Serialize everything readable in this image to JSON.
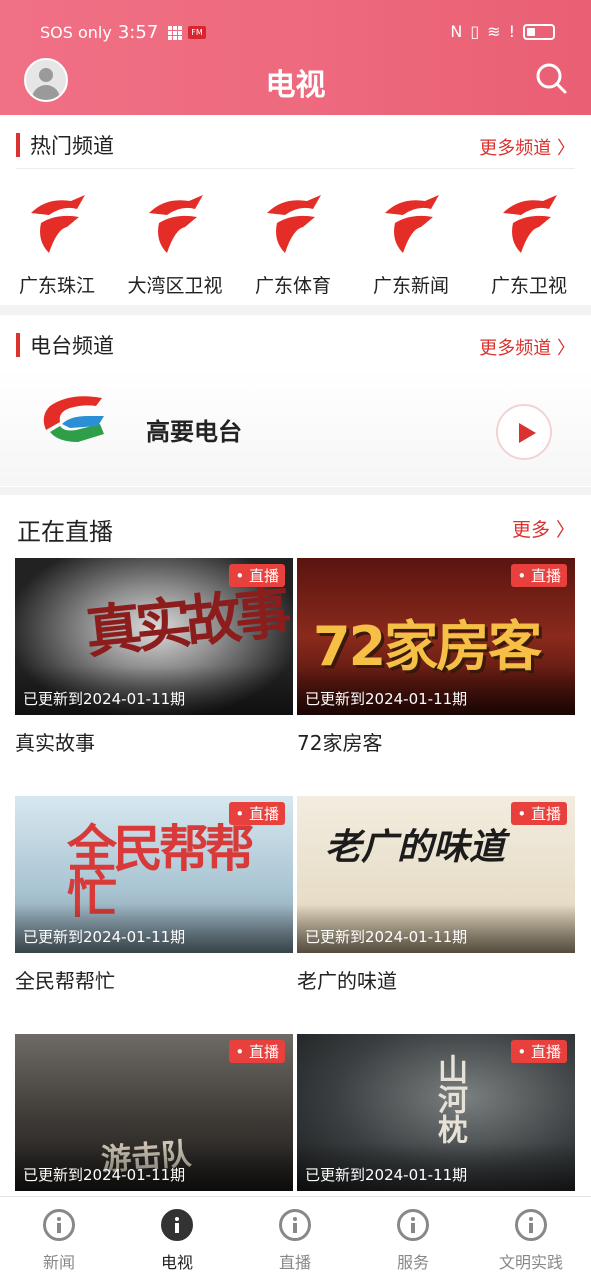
{
  "status_bar": {
    "carrier": "SOS only",
    "time": "3:57",
    "badge": "FM"
  },
  "header": {
    "title": "电视"
  },
  "hot_channels": {
    "title": "热门频道",
    "more": "更多频道 〉",
    "items": [
      {
        "label": "广东珠江"
      },
      {
        "label": "大湾区卫视"
      },
      {
        "label": "广东体育"
      },
      {
        "label": "广东新闻"
      },
      {
        "label": "广东卫视"
      }
    ]
  },
  "radio": {
    "title": "电台频道",
    "more": "更多频道 〉",
    "station": "高要电台"
  },
  "live": {
    "title": "正在直播",
    "more": "更多 〉",
    "badge": "• 直播",
    "items": [
      {
        "title": "真实故事",
        "updated": "已更新到2024-01-11期",
        "art": "真实故事"
      },
      {
        "title": "72家房客",
        "updated": "已更新到2024-01-11期",
        "art": "72家房客"
      },
      {
        "title": "全民帮帮忙",
        "updated": "已更新到2024-01-11期",
        "art": "全民帮帮忙"
      },
      {
        "title": "老广的味道",
        "updated": "已更新到2024-01-11期",
        "art": "老广的味道"
      },
      {
        "title": "",
        "updated": "已更新到2024-01-11期",
        "art": "游击队"
      },
      {
        "title": "",
        "updated": "已更新到2024-01-11期",
        "art": "山河枕"
      }
    ]
  },
  "tabs": [
    {
      "label": "新闻"
    },
    {
      "label": "电视"
    },
    {
      "label": "直播"
    },
    {
      "label": "服务"
    },
    {
      "label": "文明实践"
    }
  ],
  "colors": {
    "header": "#ee6a7e",
    "accent": "#d9322f",
    "live_badge": "#e8413d"
  }
}
